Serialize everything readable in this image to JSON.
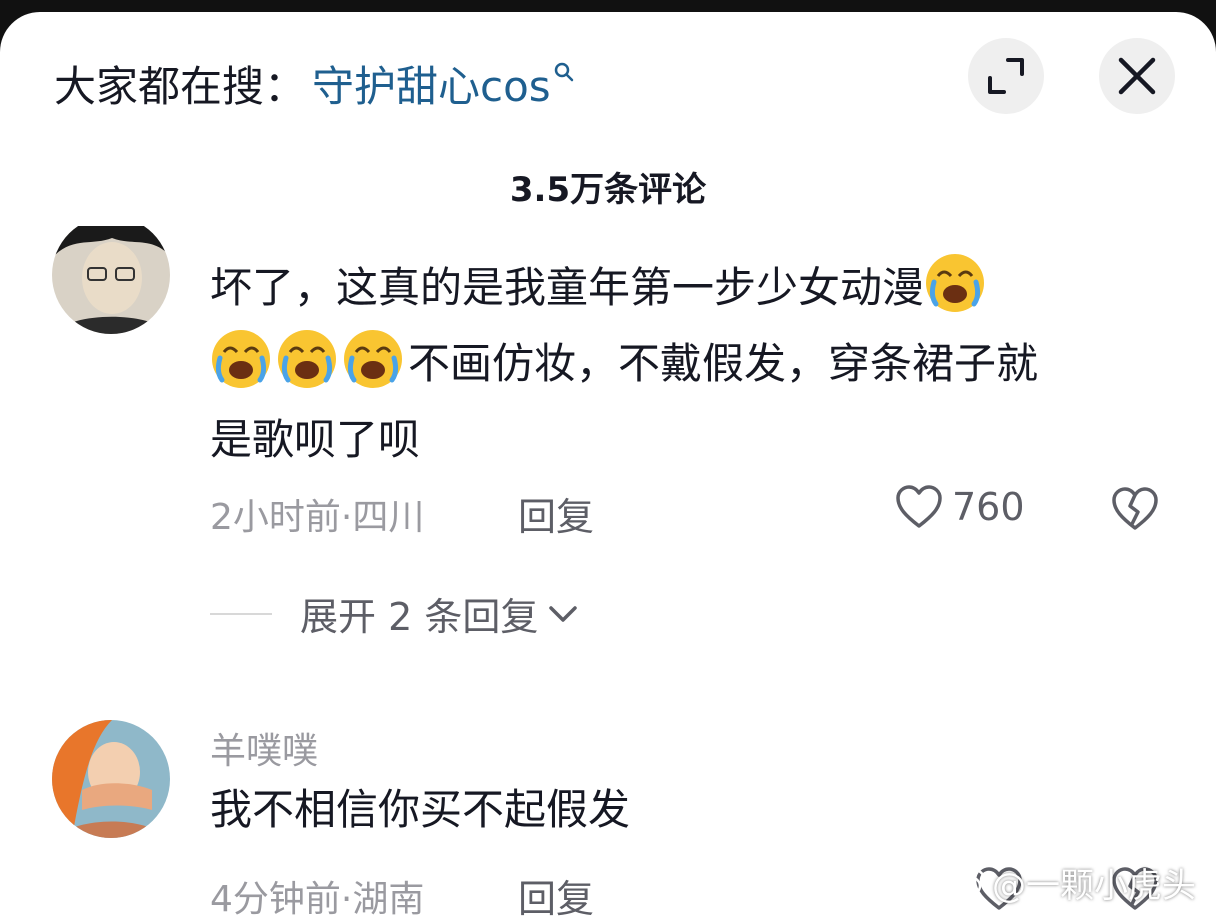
{
  "header": {
    "search_prefix": "大家都在搜：",
    "search_term": "守护甜心cos",
    "comment_count": "3.5万条评论"
  },
  "comments": [
    {
      "text_line1": "坏了，这真的是我童年第一步少女动漫",
      "text_line2": "不画仿妆，不戴假发，穿条裙子就",
      "text_line3": "是歌呗了呗",
      "emoji_icon": "crying-laughing-emoji",
      "meta": "2小时前·四川",
      "reply_label": "回复",
      "likes": "760",
      "expand_replies": "展开 2 条回复"
    },
    {
      "username": "羊噗噗",
      "text": "我不相信你买不起假发",
      "meta": "4分钟前·湖南",
      "reply_label": "回复"
    }
  ],
  "watermark": "@一颗小虎头",
  "colors": {
    "search_term": "#1f5f8f",
    "text": "#161823",
    "secondary": "#9a9aa0",
    "button_bg": "#efefef"
  }
}
